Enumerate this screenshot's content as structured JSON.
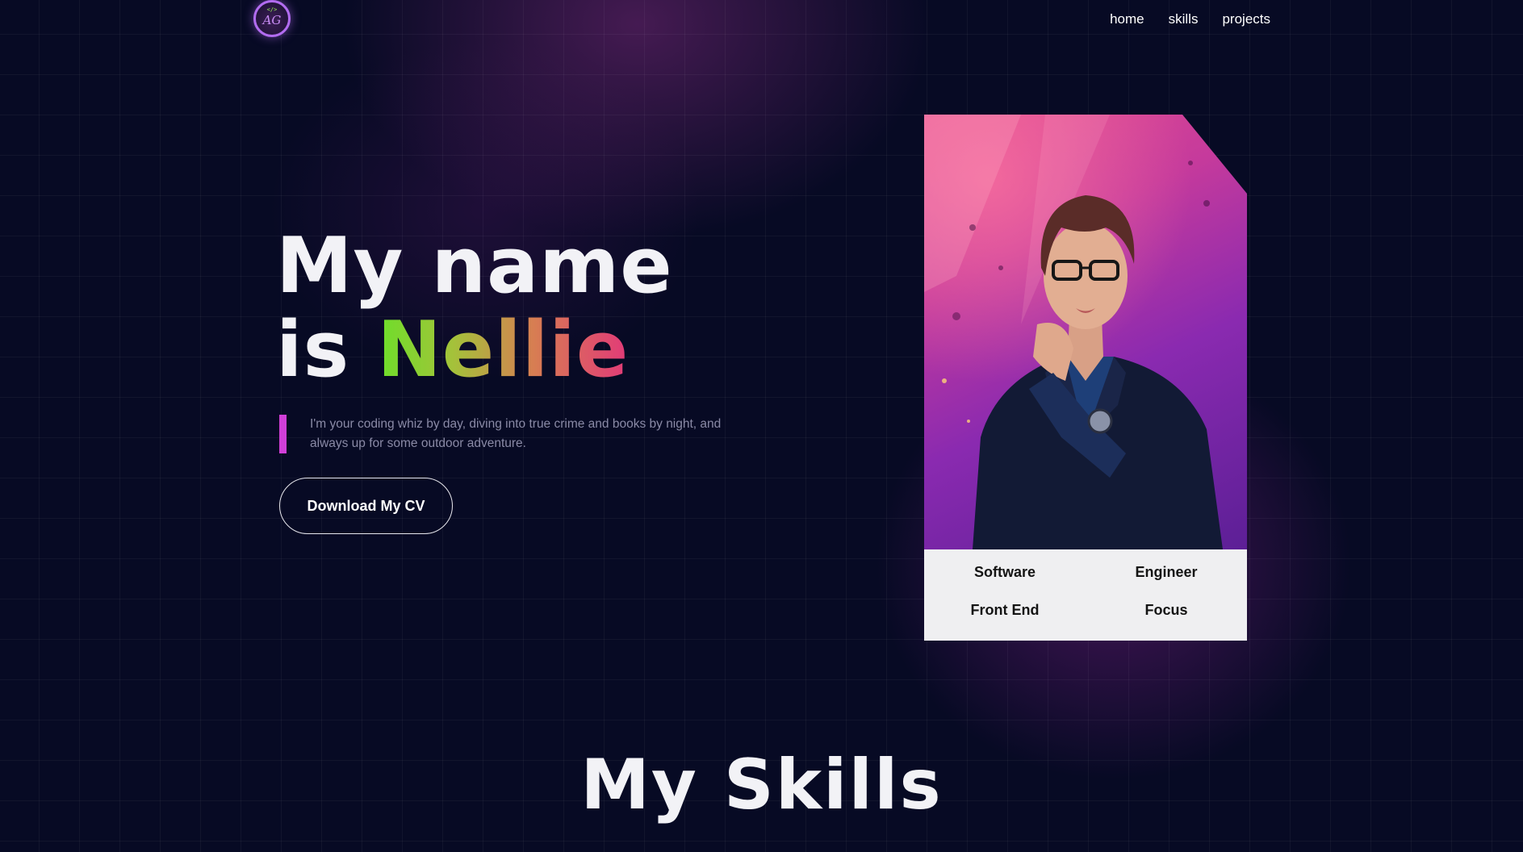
{
  "header": {
    "logo": {
      "code_glyph": "</>",
      "initials": "AG"
    },
    "nav": [
      {
        "label": "home"
      },
      {
        "label": "skills"
      },
      {
        "label": "projects"
      }
    ]
  },
  "hero": {
    "title_line1": "My name",
    "title_prefix": "is ",
    "title_name": "Nellie",
    "tagline": "I'm your coding whiz by day, diving into true crime and books by night, and always up for some outdoor adventure.",
    "cta_label": "Download My CV"
  },
  "profile_card": {
    "info": [
      "Software",
      "Engineer",
      "Front End",
      "Focus"
    ]
  },
  "skills": {
    "title": "My Skills"
  },
  "colors": {
    "background": "#070a24",
    "accent_bar": "#d13fd8",
    "logo_ring": "#b26cf0",
    "name_gradient": [
      "#6ddf2a",
      "#d77e52",
      "#e23a78"
    ],
    "card_info_bg": "#efeff1"
  }
}
